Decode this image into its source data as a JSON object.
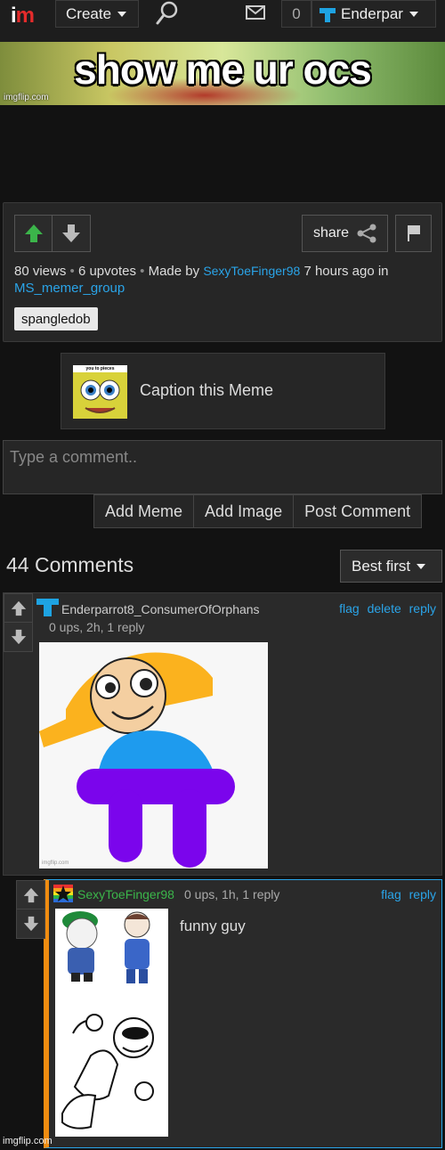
{
  "nav": {
    "logo_i": "i",
    "logo_m": "m",
    "create_label": "Create",
    "notif_count": "0",
    "username": "Enderpar"
  },
  "banner": {
    "text": "show me ur ocs",
    "watermark": "imgflip.com"
  },
  "post": {
    "views": "80 views",
    "upvotes": "6 upvotes",
    "made_by_prefix": "Made by",
    "author": "SexyToeFinger98",
    "time_in": "7 hours ago in",
    "stream": "MS_memer_group",
    "share_label": "share",
    "tag": "spangledob"
  },
  "caption": {
    "thumb_text": "you to pieces",
    "label": "Caption this Meme"
  },
  "comment_form": {
    "placeholder": "Type a comment..",
    "add_meme": "Add Meme",
    "add_image": "Add Image",
    "post_comment": "Post Comment"
  },
  "comments_header": {
    "count_label": "44 Comments",
    "sort_label": "Best first"
  },
  "comments": [
    {
      "author": "Enderparrot8_ConsumerOfOrphans",
      "stats": "0 ups, 2h, 1 reply",
      "actions": {
        "flag": "flag",
        "delete": "delete",
        "reply": "reply"
      },
      "image_watermark": "imgflip.com"
    },
    {
      "author": "SexyToeFinger98",
      "stats": "0 ups, 1h, 1 reply",
      "actions": {
        "flag": "flag",
        "reply": "reply"
      },
      "text": "funny guy"
    }
  ],
  "footer": {
    "watermark": "imgflip.com"
  },
  "colors": {
    "link": "#2aa4e8",
    "upvote": "#3bb54a",
    "reply_bar": "#f08c10",
    "logo_red": "#e52b2b"
  }
}
